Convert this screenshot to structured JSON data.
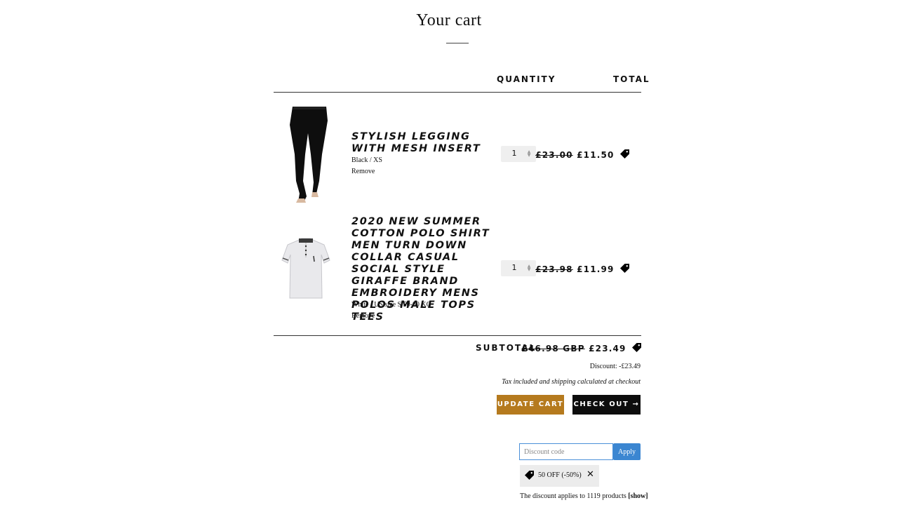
{
  "page": {
    "title": "Your cart"
  },
  "table": {
    "quantity_header": "QUANTITY",
    "total_header": "TOTAL"
  },
  "items": [
    {
      "name": "Stylish Legging with Mesh Insert",
      "variant": "Black / XS",
      "remove_label": "Remove",
      "quantity": "1",
      "original_price": "£23.00",
      "price": "£11.50"
    },
    {
      "name": "2020 New Summer Cotton Polo Shirt Men Turn Down Collar Casual Social Style Giraffe Brand Embroidery Mens Polos Male Tops Tees",
      "variant": "White / US size S 50-60 KG",
      "remove_label": "Remove",
      "quantity": "1",
      "original_price": "£23.98",
      "price": "£11.99"
    }
  ],
  "summary": {
    "subtotal_label": "SUBTOTAL",
    "original_subtotal": "£46.98 GBP",
    "subtotal": "£23.49",
    "discount_text": "Discount: -£23.49",
    "tax_note": "Tax included and shipping calculated at checkout"
  },
  "buttons": {
    "update_cart": "UPDATE CART",
    "checkout": "CHECK OUT →"
  },
  "discount": {
    "placeholder": "Discount code",
    "apply_label": "Apply",
    "applied_code": "50 OFF (-50%)",
    "applies_text": "The discount applies to 1119 products",
    "show_link": "[show]"
  },
  "colors": {
    "update_button": "#b57a1e",
    "checkout_button": "#0d0d0d",
    "apply_button": "#3b86d1",
    "input_border": "#4a90d9"
  },
  "icons": [
    "price-tag-icon",
    "close-icon",
    "stepper-arrows-icon"
  ]
}
